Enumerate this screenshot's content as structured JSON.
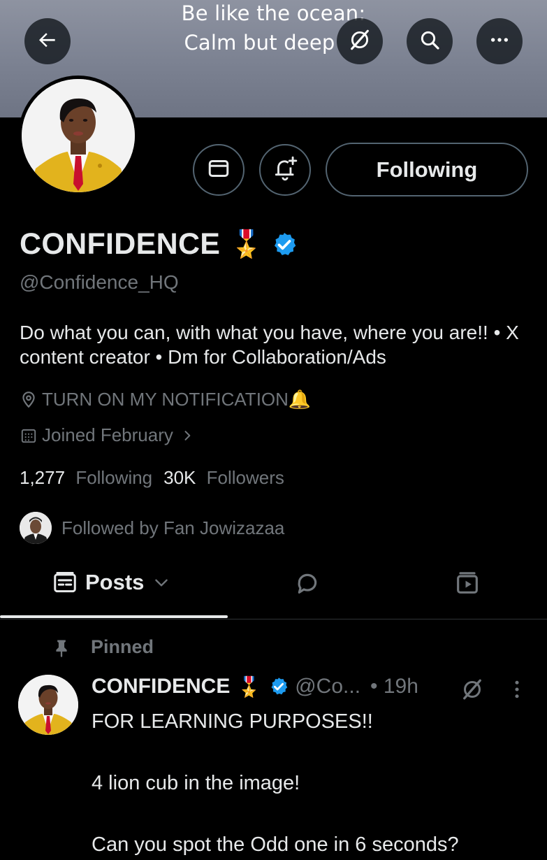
{
  "banner": {
    "line1": "Be like the ocean:",
    "line2": "Calm but deep"
  },
  "header_icons": {
    "back": "back-arrow-icon",
    "grok": "grok-icon",
    "search": "search-icon",
    "more": "more-horizontal-icon"
  },
  "actions": {
    "message": "mail-icon",
    "notify": "bell-plus-icon",
    "following_label": "Following"
  },
  "profile": {
    "name": "CONFIDENCE",
    "name_emoji": "🎖️",
    "handle": "@Confidence_HQ",
    "bio": "Do what you can, with what you have, where you are!! • X content creator • Dm for Collaboration/Ads",
    "location": "TURN ON MY NOTIFICATION🔔",
    "joined": "Joined February",
    "following_count": "1,277",
    "following_label": "Following",
    "followers_count": "30K",
    "followers_label": "Followers",
    "followed_by": "Followed by Fan Jowizazaa"
  },
  "tabs": {
    "posts_label": "Posts"
  },
  "pinned": {
    "label": "Pinned",
    "author": "CONFIDENCE",
    "author_emoji": "🎖️",
    "handle": "@Co...",
    "time": "• 19h",
    "line1": "FOR LEARNING PURPOSES!!",
    "line2": "",
    "line3": "4 lion cub in the image!",
    "line4": "",
    "line5": "Can you spot the Odd one in 6 seconds?"
  },
  "colors": {
    "background": "#000000",
    "text": "#e7e9ea",
    "muted": "#71767b",
    "verified": "#1d9bf0",
    "border": "#536471"
  }
}
